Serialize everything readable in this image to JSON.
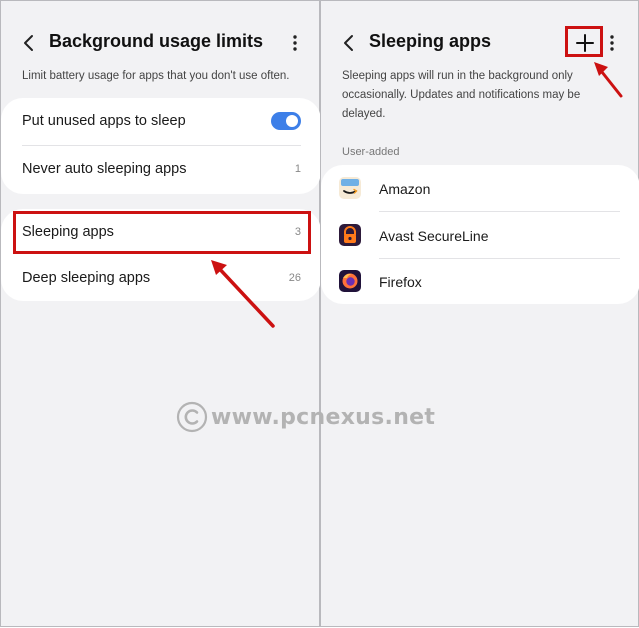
{
  "left": {
    "title": "Background usage limits",
    "description": "Limit battery usage for apps that you don't use often.",
    "rows": [
      {
        "label": "Put unused apps to sleep",
        "toggle_on": true
      },
      {
        "label": "Never auto sleeping apps",
        "count": "1"
      },
      {
        "label": "Sleeping apps",
        "count": "3"
      },
      {
        "label": "Deep sleeping apps",
        "count": "26"
      }
    ]
  },
  "right": {
    "title": "Sleeping apps",
    "add_icon": "plus-icon",
    "description": "Sleeping apps will run in the background only occasionally. Updates and notifications may be delayed.",
    "section": "User-added",
    "apps": [
      {
        "name": "Amazon",
        "icon": "amazon-icon"
      },
      {
        "name": "Avast SecureLine",
        "icon": "avast-secureline-icon"
      },
      {
        "name": "Firefox",
        "icon": "firefox-icon"
      }
    ]
  },
  "watermark": "www.pcnexus.net",
  "colors": {
    "accent": "#3d7fe8",
    "highlight": "#cc1111",
    "background": "#f2f2f4"
  }
}
